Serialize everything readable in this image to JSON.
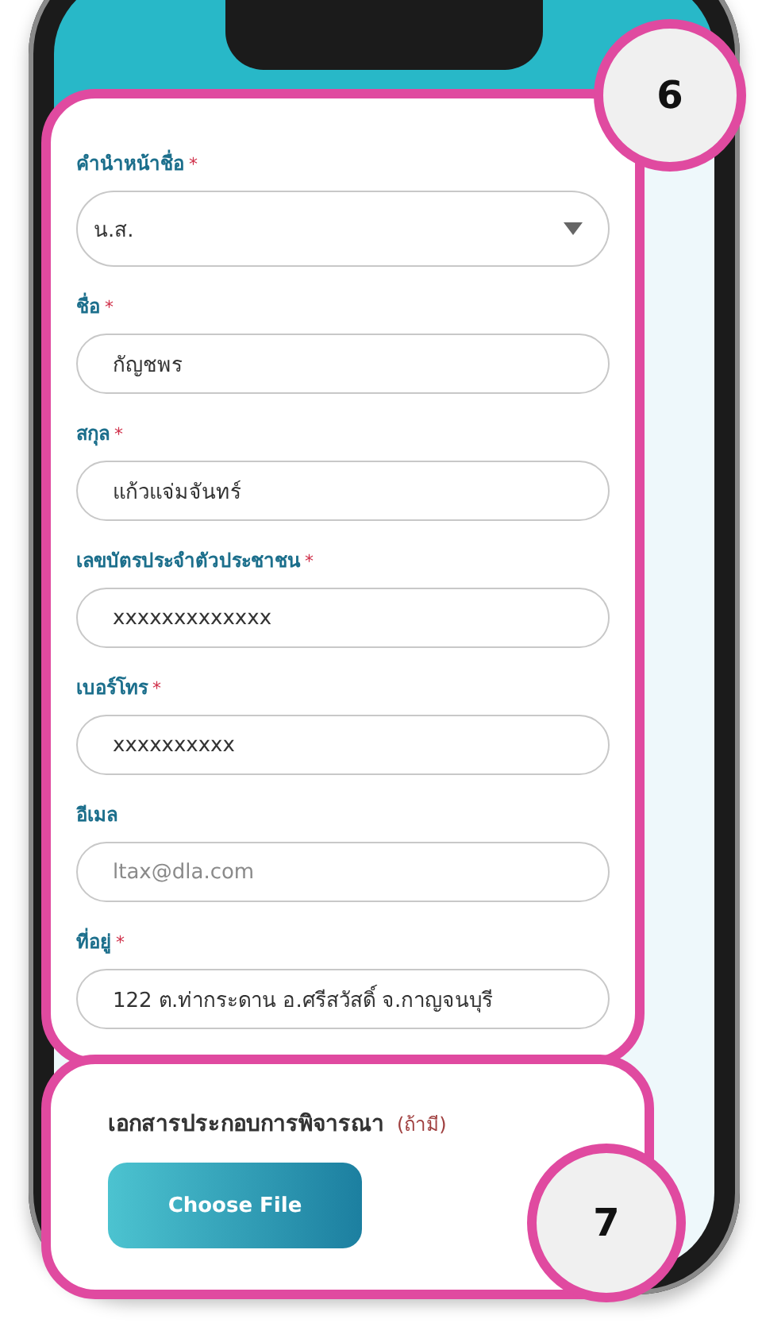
{
  "form_fields": [
    {
      "label": "คำนำหน้าชื่อ",
      "required_mark": "*",
      "kind": "select",
      "value": "น.ส."
    },
    {
      "label": "ชื่อ",
      "required_mark": "*",
      "kind": "text",
      "value": "กัญชพร"
    },
    {
      "label": "สกุล",
      "required_mark": "*",
      "kind": "text",
      "value": "แก้วแจ่มจันทร์"
    },
    {
      "label": "เลขบัตรประจำตัวประชาชน",
      "required_mark": "*",
      "kind": "text",
      "value": "xxxxxxxxxxxxx"
    },
    {
      "label": "เบอร์โทร",
      "required_mark": "*",
      "kind": "text",
      "value": "xxxxxxxxxx"
    },
    {
      "label": "อีเมล",
      "kind": "text",
      "placeholder": "ltax@dla.com"
    },
    {
      "label": "ที่อยู่",
      "required_mark": "*",
      "kind": "text",
      "value": "122 ต.ท่ากระดาน อ.ศรีสวัสดิ์ จ.กาญจนบุรี"
    }
  ],
  "documents": {
    "title": "เอกสารประกอบการพิจารณา",
    "note": "(ถ้ามี)",
    "button": "Choose File"
  },
  "annotations": [
    "6",
    "7"
  ]
}
